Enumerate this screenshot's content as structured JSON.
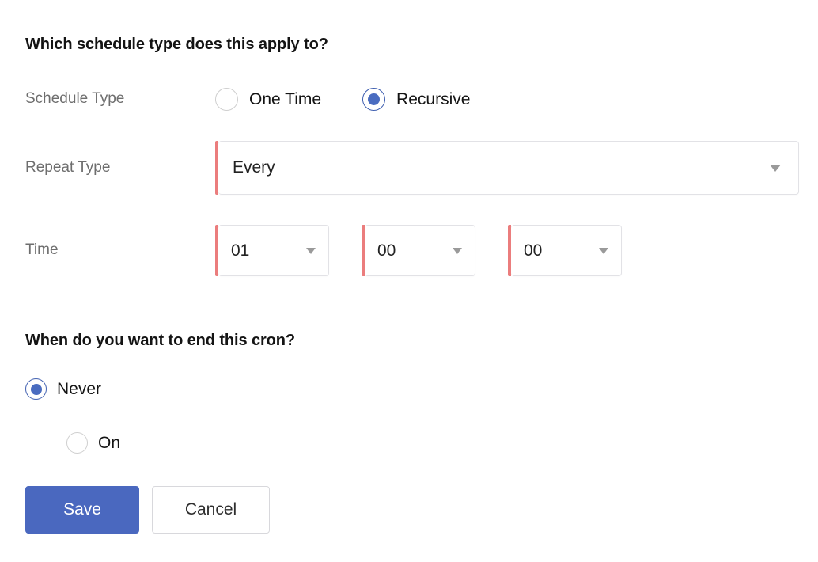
{
  "form": {
    "schedule_section": {
      "heading": "Which schedule type does this apply to?",
      "schedule_type": {
        "label": "Schedule Type",
        "options": [
          {
            "label": "One Time",
            "selected": false
          },
          {
            "label": "Recursive",
            "selected": true
          }
        ]
      },
      "repeat_type": {
        "label": "Repeat Type",
        "value": "Every",
        "required": true,
        "caret_icon": "chevron-down-icon"
      },
      "time": {
        "label": "Time",
        "required": true,
        "hour": "01",
        "minute": "00",
        "second": "00",
        "caret_icon": "chevron-down-icon"
      }
    },
    "end_section": {
      "heading": "When do you want to end this cron?",
      "options": [
        {
          "label": "Never",
          "selected": true
        },
        {
          "label": "On",
          "selected": false
        }
      ]
    },
    "actions": {
      "save_label": "Save",
      "cancel_label": "Cancel"
    }
  },
  "colors": {
    "accent_blue": "#4a68bf",
    "radio_blue": "#4a6cc0",
    "required_red": "#eb7d7d",
    "label_gray": "#6e6e6e",
    "border_gray": "#e2e2e6",
    "heading_black": "#141414"
  }
}
